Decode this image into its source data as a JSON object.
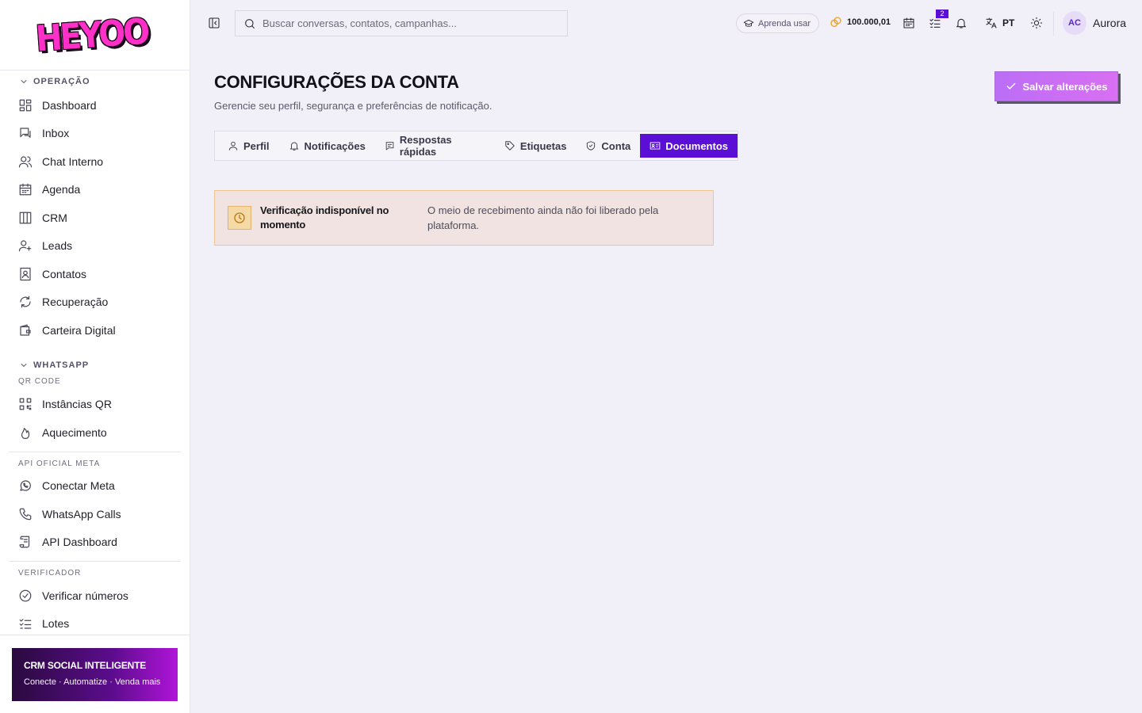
{
  "brand": {
    "logo_text": "HEYOO"
  },
  "sidebar": {
    "sections": [
      {
        "title": "OPERAÇÃO"
      },
      {
        "title": "WHATSAPP"
      }
    ],
    "operacao_items": [
      {
        "label": "Dashboard",
        "icon": "dashboard-icon"
      },
      {
        "label": "Inbox",
        "icon": "inbox-icon"
      },
      {
        "label": "Chat Interno",
        "icon": "users-icon"
      },
      {
        "label": "Agenda",
        "icon": "calendar-icon"
      },
      {
        "label": "CRM",
        "icon": "columns-icon"
      },
      {
        "label": "Leads",
        "icon": "user-plus-icon"
      },
      {
        "label": "Contatos",
        "icon": "contact-book-icon"
      },
      {
        "label": "Recuperação",
        "icon": "refresh-icon"
      },
      {
        "label": "Carteira Digital",
        "icon": "wallet-icon"
      }
    ],
    "qr_code_label": "QR CODE",
    "qr_items": [
      {
        "label": "Instâncias QR",
        "icon": "qr-code-icon"
      },
      {
        "label": "Aquecimento",
        "icon": "flame-icon"
      }
    ],
    "api_label": "API OFICIAL META",
    "api_items": [
      {
        "label": "Conectar Meta",
        "icon": "whatsapp-icon"
      },
      {
        "label": "WhatsApp Calls",
        "icon": "phone-icon"
      },
      {
        "label": "API Dashboard",
        "icon": "scroll-icon"
      }
    ],
    "verificador_label": "VERIFICADOR",
    "verificador_items": [
      {
        "label": "Verificar números",
        "icon": "check-circle-icon"
      },
      {
        "label": "Lotes",
        "icon": "list-check-icon"
      }
    ],
    "promo": {
      "title": "CRM SOCIAL INTELIGENTE",
      "subtitle": "Conecte · Automatize · Venda mais"
    }
  },
  "topbar": {
    "search_placeholder": "Buscar conversas, contatos, campanhas...",
    "learn_label": "Aprenda usar",
    "coins_value": "100.000,01",
    "tasks_badge": "2",
    "language": "PT",
    "user": {
      "initials": "AC",
      "name": "Aurora"
    }
  },
  "main": {
    "title": "CONFIGURAÇÕES DA CONTA",
    "subtitle": "Gerencie seu perfil, segurança e preferências de notificação.",
    "save_label": "Salvar alterações",
    "tabs": [
      {
        "label": "Perfil",
        "icon": "user-icon",
        "active": false
      },
      {
        "label": "Notificações",
        "icon": "bell-icon",
        "active": false
      },
      {
        "label": "Respostas rápidas",
        "icon": "message-icon",
        "active": false
      },
      {
        "label": "Etiquetas",
        "icon": "tag-icon",
        "active": false
      },
      {
        "label": "Conta",
        "icon": "shield-icon",
        "active": false
      },
      {
        "label": "Documentos",
        "icon": "id-card-icon",
        "active": true
      }
    ],
    "alert": {
      "title": "Verificação indisponível no momento",
      "description": "O meio de recebimento ainda não foi liberado pela plataforma.",
      "icon": "clock-icon"
    }
  },
  "colors": {
    "accent": "#5b0fd6",
    "save_gradient_start": "#bb6ef6",
    "save_gradient_end": "#d96ff2",
    "alert_bg": "#f0e3e1",
    "alert_border": "#efc68f",
    "page_bg": "#f1eff8"
  }
}
